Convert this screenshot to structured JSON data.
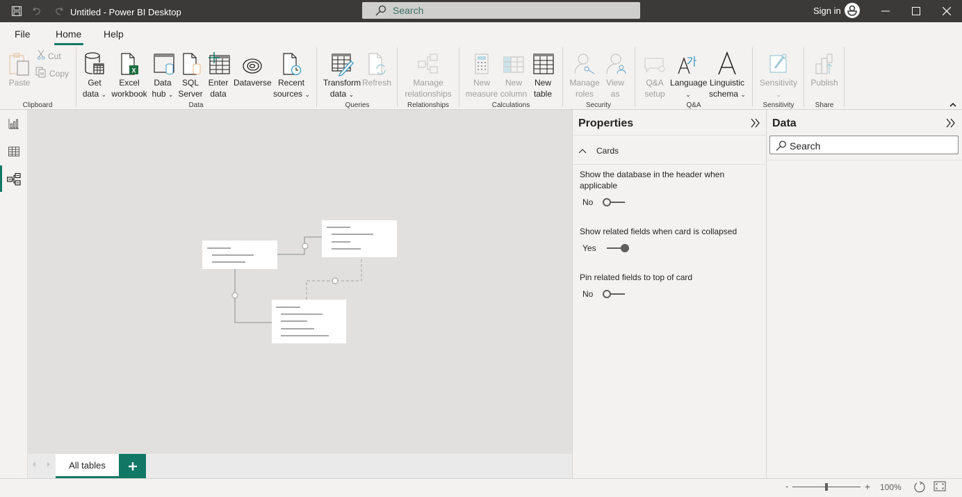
{
  "titlebar": {
    "title": "Untitled - Power BI Desktop",
    "search_placeholder": "Search",
    "sign_in": "Sign in"
  },
  "menu": {
    "tabs": [
      {
        "label": "File",
        "active": false
      },
      {
        "label": "Home",
        "active": true
      },
      {
        "label": "Help",
        "active": false
      }
    ]
  },
  "ribbon": {
    "groups": {
      "clipboard": "Clipboard",
      "data": "Data",
      "queries": "Queries",
      "relationships": "Relationships",
      "calculations": "Calculations",
      "security": "Security",
      "qa": "Q&A",
      "sensitivity": "Sensitivity",
      "share": "Share"
    },
    "buttons": {
      "paste": "Paste",
      "cut": "Cut",
      "copy": "Copy",
      "get_data_1": "Get",
      "get_data_2": "data",
      "excel_1": "Excel",
      "excel_2": "workbook",
      "data_hub_1": "Data",
      "data_hub_2": "hub",
      "sql_1": "SQL",
      "sql_2": "Server",
      "enter_1": "Enter",
      "enter_2": "data",
      "dataverse": "Dataverse",
      "recent_1": "Recent",
      "recent_2": "sources",
      "transform_1": "Transform",
      "transform_2": "data",
      "refresh": "Refresh",
      "manage_rel_1": "Manage",
      "manage_rel_2": "relationships",
      "new_measure_1": "New",
      "new_measure_2": "measure",
      "new_column_1": "New",
      "new_column_2": "column",
      "new_table_1": "New",
      "new_table_2": "table",
      "manage_roles_1": "Manage",
      "manage_roles_2": "roles",
      "view_as_1": "View",
      "view_as_2": "as",
      "qa_setup_1": "Q&A",
      "qa_setup_2": "setup",
      "language": "Language",
      "linguistic_1": "Linguistic",
      "linguistic_2": "schema",
      "sensitivity": "Sensitivity",
      "publish": "Publish"
    }
  },
  "canvas": {
    "page_tab": "All tables"
  },
  "properties": {
    "title": "Properties",
    "section": "Cards",
    "settings": [
      {
        "label": "Show the database in the header when applicable",
        "value": "No",
        "on": false
      },
      {
        "label": "Show related fields when card is collapsed",
        "value": "Yes",
        "on": true
      },
      {
        "label": "Pin related fields to top of card",
        "value": "No",
        "on": false
      }
    ]
  },
  "data_pane": {
    "title": "Data",
    "search_placeholder": "Search"
  },
  "status": {
    "zoom_minus": "-",
    "zoom_plus": "+",
    "zoom_level": "100%",
    "zoom_fraction": 0.5
  },
  "colors": {
    "accent": "#117865",
    "titlebar": "#3b3a39",
    "canvas": "#e1e0df"
  }
}
